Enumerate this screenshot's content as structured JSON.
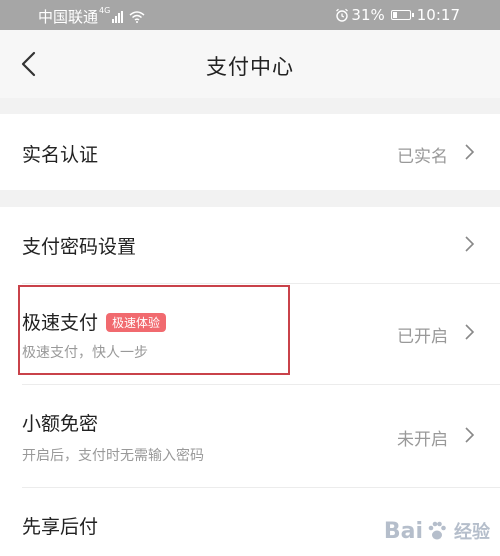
{
  "status_bar": {
    "carrier": "中国联通",
    "network": "4G",
    "battery": "31%",
    "battery_level": 0.31,
    "time": "10:17"
  },
  "nav": {
    "title": "支付中心"
  },
  "rows": {
    "real_name": {
      "label": "实名认证",
      "value": "已实名"
    },
    "pay_password": {
      "label": "支付密码设置"
    },
    "express_pay": {
      "label": "极速支付",
      "badge": "极速体验",
      "sub": "极速支付，快人一步",
      "value": "已开启"
    },
    "small_amount": {
      "label": "小额免密",
      "sub": "开启后，支付时无需输入密码",
      "value": "未开启"
    },
    "pay_later": {
      "label": "先享后付"
    }
  },
  "watermark": {
    "brand_left": "Bai",
    "brand_right": "经验"
  },
  "colors": {
    "status_bar": "#a6a6a6",
    "badge": "#f16a6f",
    "highlight": "#c9424a"
  }
}
